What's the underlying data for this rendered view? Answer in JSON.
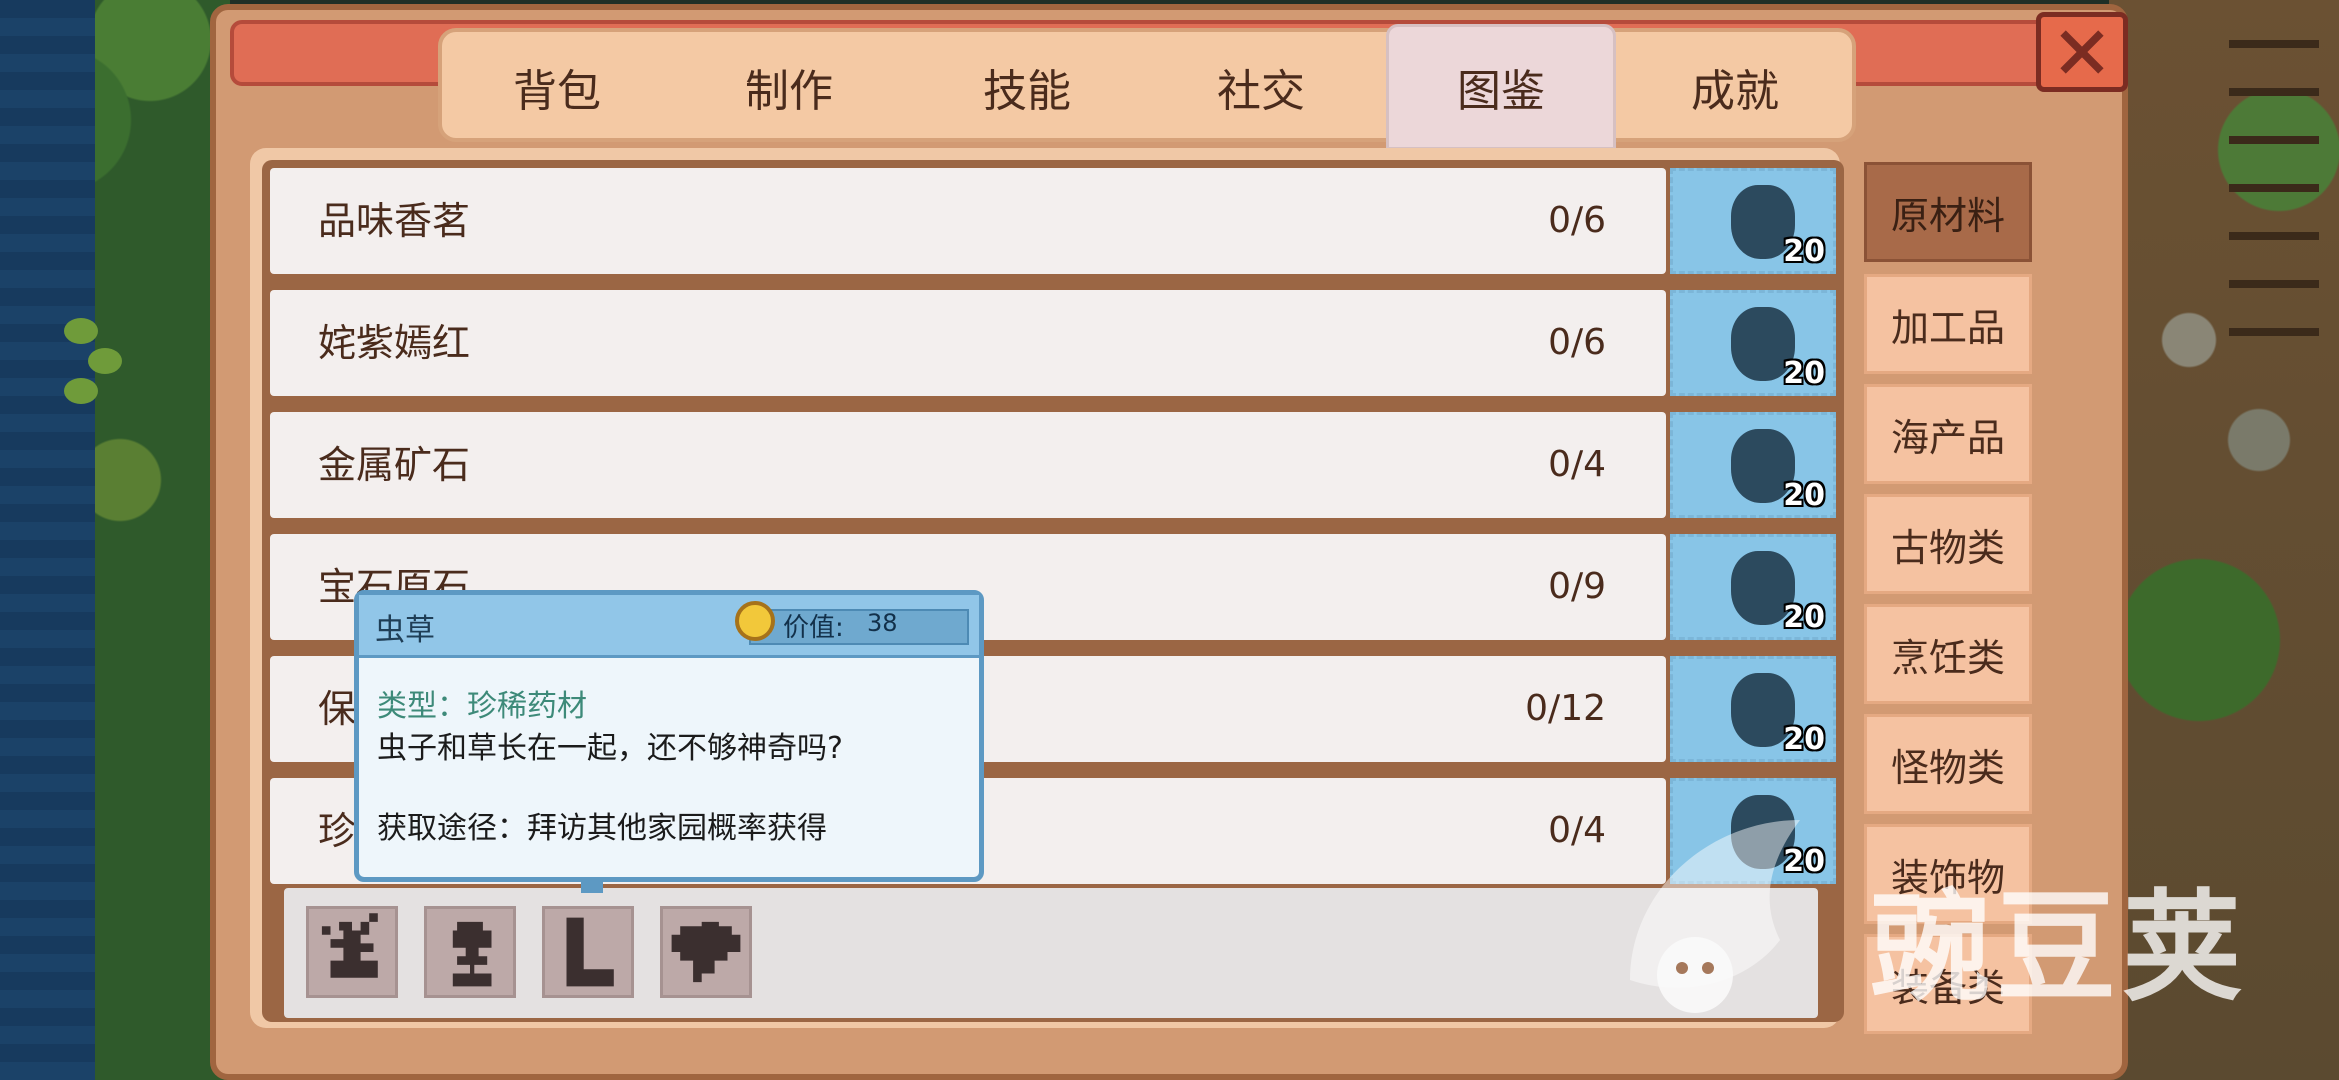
{
  "tabs": [
    {
      "label": "背包"
    },
    {
      "label": "制作"
    },
    {
      "label": "技能"
    },
    {
      "label": "社交"
    },
    {
      "label": "图鉴",
      "active": true
    },
    {
      "label": "成就"
    }
  ],
  "items": [
    {
      "name": "品味香茗",
      "count": "0/6",
      "badge": "20"
    },
    {
      "name": "姹紫嫣红",
      "count": "0/6",
      "badge": "20"
    },
    {
      "name": "金属矿石",
      "count": "0/4",
      "badge": "20"
    },
    {
      "name": "宝石原石",
      "count": "0/9",
      "badge": "20"
    },
    {
      "name": "保",
      "count": "0/12",
      "badge": "20"
    },
    {
      "name": "珍",
      "count": "0/4",
      "badge": "20"
    }
  ],
  "categories": [
    {
      "label": "原材料",
      "active": true
    },
    {
      "label": "加工品"
    },
    {
      "label": "海产品"
    },
    {
      "label": "古物类"
    },
    {
      "label": "烹饪类"
    },
    {
      "label": "怪物类"
    },
    {
      "label": "装饰物"
    },
    {
      "label": "装备类"
    }
  ],
  "tooltip": {
    "name": "虫草",
    "value_label": "价值:",
    "value": "38",
    "type": "类型：珍稀药材",
    "description": "虫子和草长在一起，还不够神奇吗?",
    "source": "获取途径：拜访其他家园概率获得"
  },
  "slots": [
    {
      "icon": "flower-silhouette-icon"
    },
    {
      "icon": "sprout-silhouette-icon"
    },
    {
      "icon": "boot-silhouette-icon"
    },
    {
      "icon": "cloud-silhouette-icon"
    }
  ],
  "watermark": {
    "text": "豌豆荚"
  },
  "colors": {
    "window": "#d29a73",
    "tab_bar": "#f4c9a4",
    "close_button": "#e66a4b",
    "icon_box": "#88c5e7",
    "category_active": "#a86a49",
    "tooltip_border": "#5d99c3"
  }
}
